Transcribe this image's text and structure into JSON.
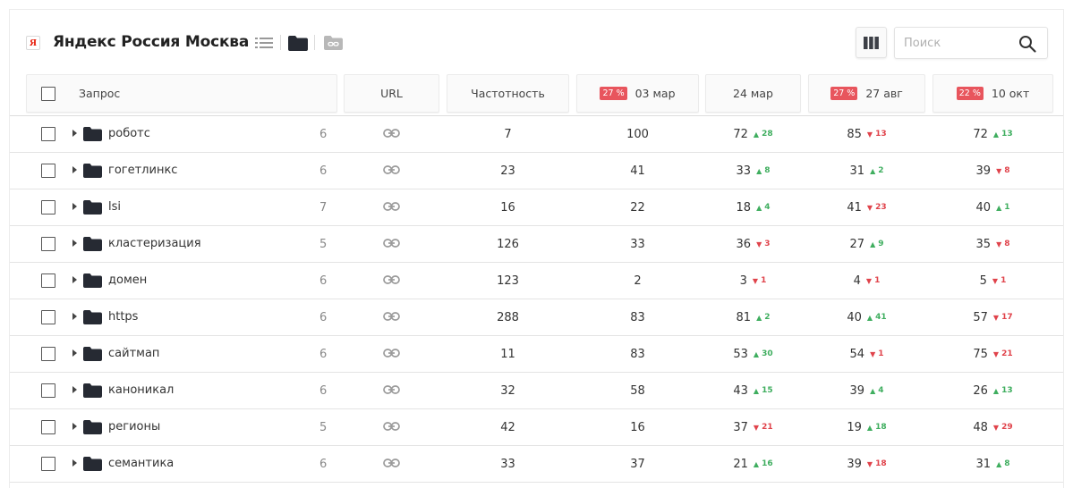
{
  "project": {
    "logo_letter": "Я",
    "title": "Яндекс Россия Москва"
  },
  "search": {
    "placeholder": "Поиск"
  },
  "colors": {
    "up": "#3fae5f",
    "down": "#e0434b",
    "badge": "#e8555d"
  },
  "columns": {
    "query": "Запрос",
    "url": "URL",
    "freq": "Частотность",
    "d1": {
      "label": "03 мар",
      "badge": "27 %"
    },
    "d2": {
      "label": "24 мар"
    },
    "d3": {
      "label": "27 авг",
      "badge": "27 %"
    },
    "d4": {
      "label": "10 окт",
      "badge": "22 %"
    }
  },
  "rows": [
    {
      "name": "роботс",
      "count": "6",
      "freq": "7",
      "d1": "100",
      "d2": {
        "pos": "72",
        "delta": "28",
        "dir": "up"
      },
      "d3": {
        "pos": "85",
        "delta": "13",
        "dir": "down"
      },
      "d4": {
        "pos": "72",
        "delta": "13",
        "dir": "up"
      }
    },
    {
      "name": "гогетлинкс",
      "count": "6",
      "freq": "23",
      "d1": "41",
      "d2": {
        "pos": "33",
        "delta": "8",
        "dir": "up"
      },
      "d3": {
        "pos": "31",
        "delta": "2",
        "dir": "up"
      },
      "d4": {
        "pos": "39",
        "delta": "8",
        "dir": "down"
      }
    },
    {
      "name": "lsi",
      "count": "7",
      "freq": "16",
      "d1": "22",
      "d2": {
        "pos": "18",
        "delta": "4",
        "dir": "up"
      },
      "d3": {
        "pos": "41",
        "delta": "23",
        "dir": "down"
      },
      "d4": {
        "pos": "40",
        "delta": "1",
        "dir": "up"
      }
    },
    {
      "name": "кластеризация",
      "count": "5",
      "freq": "126",
      "d1": "33",
      "d2": {
        "pos": "36",
        "delta": "3",
        "dir": "down"
      },
      "d3": {
        "pos": "27",
        "delta": "9",
        "dir": "up"
      },
      "d4": {
        "pos": "35",
        "delta": "8",
        "dir": "down"
      }
    },
    {
      "name": "домен",
      "count": "6",
      "freq": "123",
      "d1": "2",
      "d2": {
        "pos": "3",
        "delta": "1",
        "dir": "down"
      },
      "d3": {
        "pos": "4",
        "delta": "1",
        "dir": "down"
      },
      "d4": {
        "pos": "5",
        "delta": "1",
        "dir": "down"
      }
    },
    {
      "name": "https",
      "count": "6",
      "freq": "288",
      "d1": "83",
      "d2": {
        "pos": "81",
        "delta": "2",
        "dir": "up"
      },
      "d3": {
        "pos": "40",
        "delta": "41",
        "dir": "up"
      },
      "d4": {
        "pos": "57",
        "delta": "17",
        "dir": "down"
      }
    },
    {
      "name": "сайтмап",
      "count": "6",
      "freq": "11",
      "d1": "83",
      "d2": {
        "pos": "53",
        "delta": "30",
        "dir": "up"
      },
      "d3": {
        "pos": "54",
        "delta": "1",
        "dir": "down"
      },
      "d4": {
        "pos": "75",
        "delta": "21",
        "dir": "down"
      }
    },
    {
      "name": "каноникал",
      "count": "6",
      "freq": "32",
      "d1": "58",
      "d2": {
        "pos": "43",
        "delta": "15",
        "dir": "up"
      },
      "d3": {
        "pos": "39",
        "delta": "4",
        "dir": "up"
      },
      "d4": {
        "pos": "26",
        "delta": "13",
        "dir": "up"
      }
    },
    {
      "name": "регионы",
      "count": "5",
      "freq": "42",
      "d1": "16",
      "d2": {
        "pos": "37",
        "delta": "21",
        "dir": "down"
      },
      "d3": {
        "pos": "19",
        "delta": "18",
        "dir": "up"
      },
      "d4": {
        "pos": "48",
        "delta": "29",
        "dir": "down"
      }
    },
    {
      "name": "семантика",
      "count": "6",
      "freq": "33",
      "d1": "37",
      "d2": {
        "pos": "21",
        "delta": "16",
        "dir": "up"
      },
      "d3": {
        "pos": "39",
        "delta": "18",
        "dir": "down"
      },
      "d4": {
        "pos": "31",
        "delta": "8",
        "dir": "up"
      }
    }
  ]
}
